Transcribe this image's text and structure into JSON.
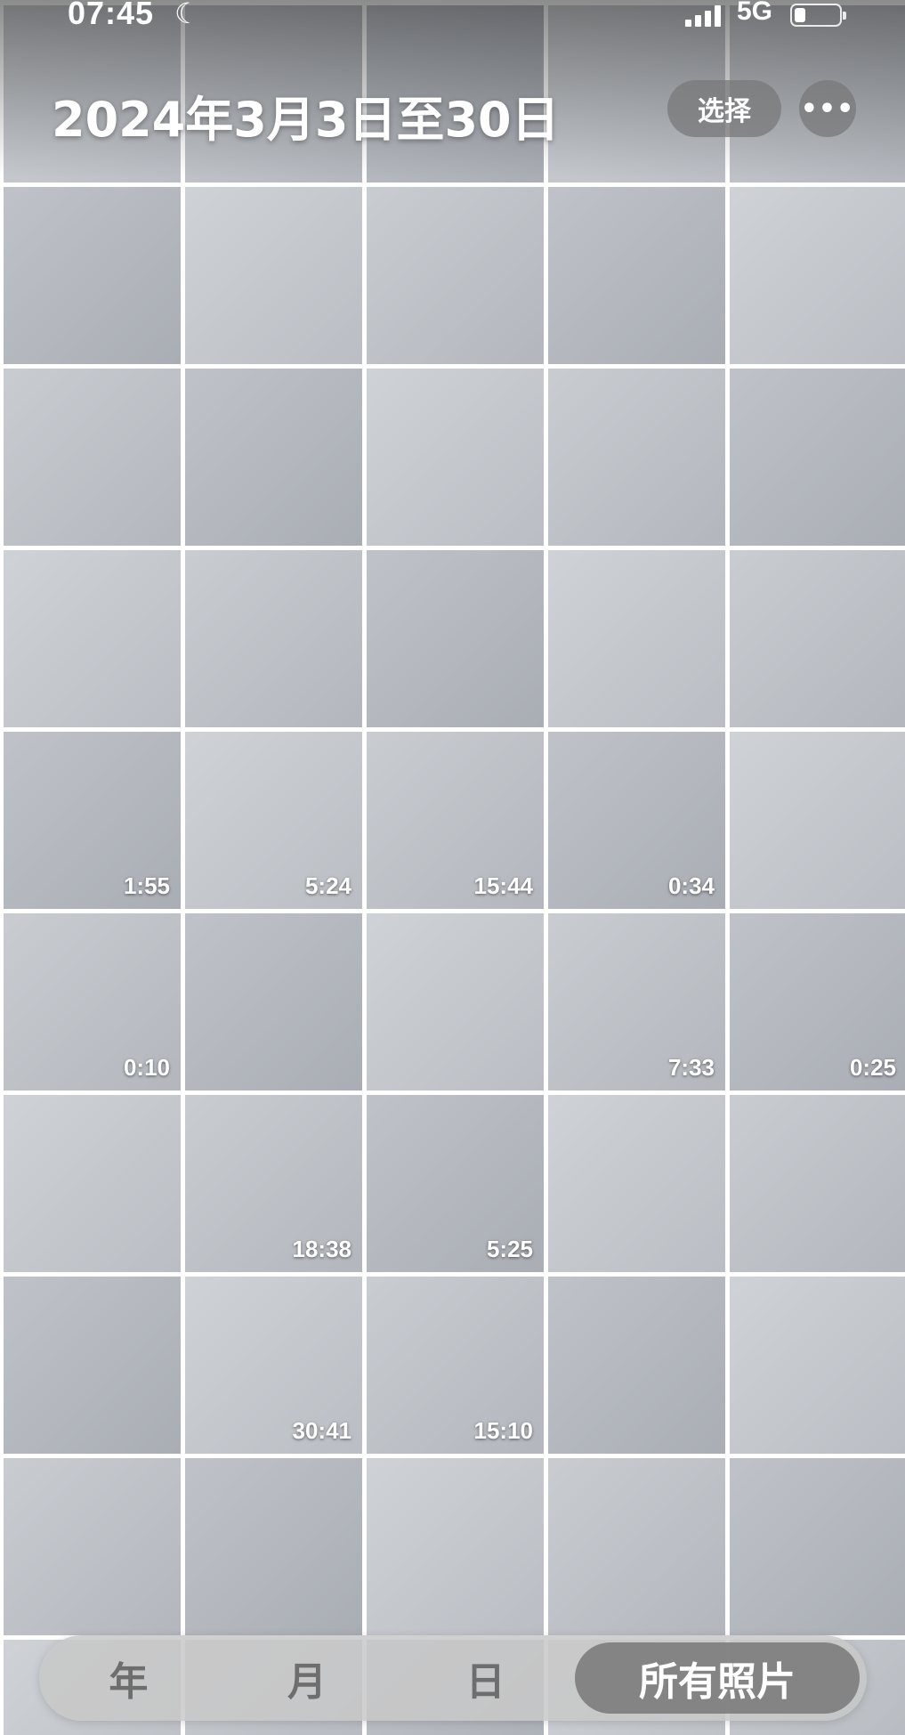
{
  "status_bar": {
    "time": "07:45",
    "network": "5G",
    "moon_icon": "moon-icon",
    "signal_icon": "cellular-signal-icon",
    "battery_icon": "battery-icon"
  },
  "header": {
    "title": "2024年3月3日至30日",
    "select_label": "选择",
    "more_label": "•••"
  },
  "grid": {
    "columns": 5,
    "tiles": [
      {
        "type": "photo"
      },
      {
        "type": "photo"
      },
      {
        "type": "photo"
      },
      {
        "type": "photo"
      },
      {
        "type": "photo"
      },
      {
        "type": "photo"
      },
      {
        "type": "photo"
      },
      {
        "type": "photo"
      },
      {
        "type": "photo"
      },
      {
        "type": "photo"
      },
      {
        "type": "photo"
      },
      {
        "type": "photo"
      },
      {
        "type": "photo"
      },
      {
        "type": "photo"
      },
      {
        "type": "photo"
      },
      {
        "type": "photo"
      },
      {
        "type": "photo"
      },
      {
        "type": "photo"
      },
      {
        "type": "photo"
      },
      {
        "type": "photo"
      },
      {
        "type": "video",
        "duration": "1:55"
      },
      {
        "type": "video",
        "duration": "5:24"
      },
      {
        "type": "video",
        "duration": "15:44"
      },
      {
        "type": "video",
        "duration": "0:34"
      },
      {
        "type": "photo"
      },
      {
        "type": "video",
        "duration": "0:10"
      },
      {
        "type": "photo"
      },
      {
        "type": "photo"
      },
      {
        "type": "video",
        "duration": "7:33"
      },
      {
        "type": "video",
        "duration": "0:25"
      },
      {
        "type": "photo"
      },
      {
        "type": "video",
        "duration": "18:38"
      },
      {
        "type": "video",
        "duration": "5:25"
      },
      {
        "type": "photo"
      },
      {
        "type": "photo"
      },
      {
        "type": "photo"
      },
      {
        "type": "video",
        "duration": "30:41"
      },
      {
        "type": "video",
        "duration": "15:10"
      },
      {
        "type": "photo"
      },
      {
        "type": "photo"
      },
      {
        "type": "photo"
      },
      {
        "type": "photo"
      },
      {
        "type": "photo"
      },
      {
        "type": "photo"
      },
      {
        "type": "photo"
      },
      {
        "type": "photo"
      },
      {
        "type": "photo"
      },
      {
        "type": "photo"
      },
      {
        "type": "photo"
      },
      {
        "type": "photo"
      }
    ]
  },
  "tab_bar": {
    "tabs": [
      {
        "label": "年",
        "active": false
      },
      {
        "label": "月",
        "active": false
      },
      {
        "label": "日",
        "active": false
      },
      {
        "label": "所有照片",
        "active": true
      }
    ]
  }
}
